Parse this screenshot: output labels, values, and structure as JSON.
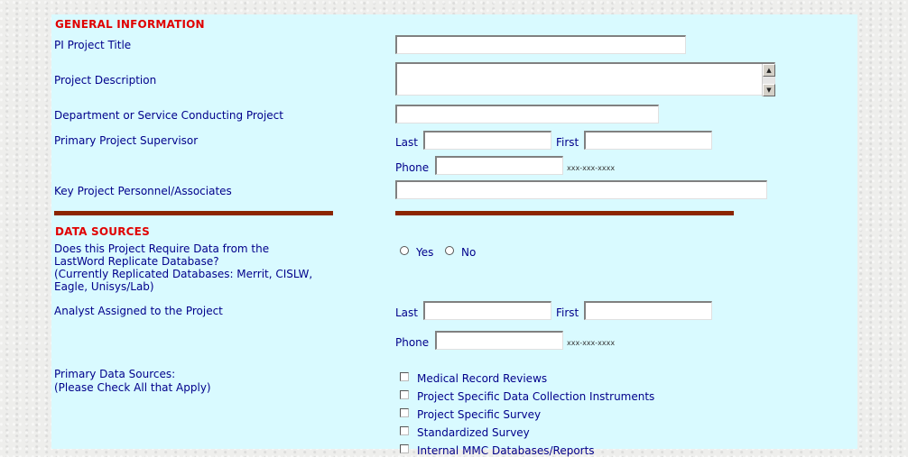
{
  "general": {
    "heading": "GENERAL INFORMATION",
    "pi_title_label": "PI Project Title",
    "description_label": "Project Description",
    "department_label": "Department or Service Conducting Project",
    "supervisor_label": "Primary Project Supervisor",
    "last_label": "Last",
    "first_label": "First",
    "phone_label": "Phone",
    "phone_hint": "xxx-xxx-xxxx",
    "personnel_label": "Key Project Personnel/Associates"
  },
  "data_sources": {
    "heading": "DATA SOURCES",
    "replicate_question": [
      "Does this Project Require Data from the",
      "LastWord Replicate Database?",
      "(Currently Replicated Databases: Merrit, CISLW,",
      "Eagle, Unisys/Lab)"
    ],
    "yes_label": "Yes",
    "no_label": "No",
    "analyst_label": "Analyst Assigned to the Project",
    "last_label": "Last",
    "first_label": "First",
    "phone_label": "Phone",
    "phone_hint": "xxx-xxx-xxxx",
    "primary_sources_label": [
      "Primary Data Sources:",
      "(Please Check All that Apply)"
    ],
    "checkboxes": [
      "Medical Record Reviews",
      "Project Specific Data Collection Instruments",
      "Project Specific Survey",
      "Standardized Survey",
      "Internal MMC Databases/Reports"
    ]
  },
  "colors": {
    "panel": "#d9faff",
    "label": "#00008b",
    "heading": "#e00000",
    "rule": "#8b2500"
  }
}
